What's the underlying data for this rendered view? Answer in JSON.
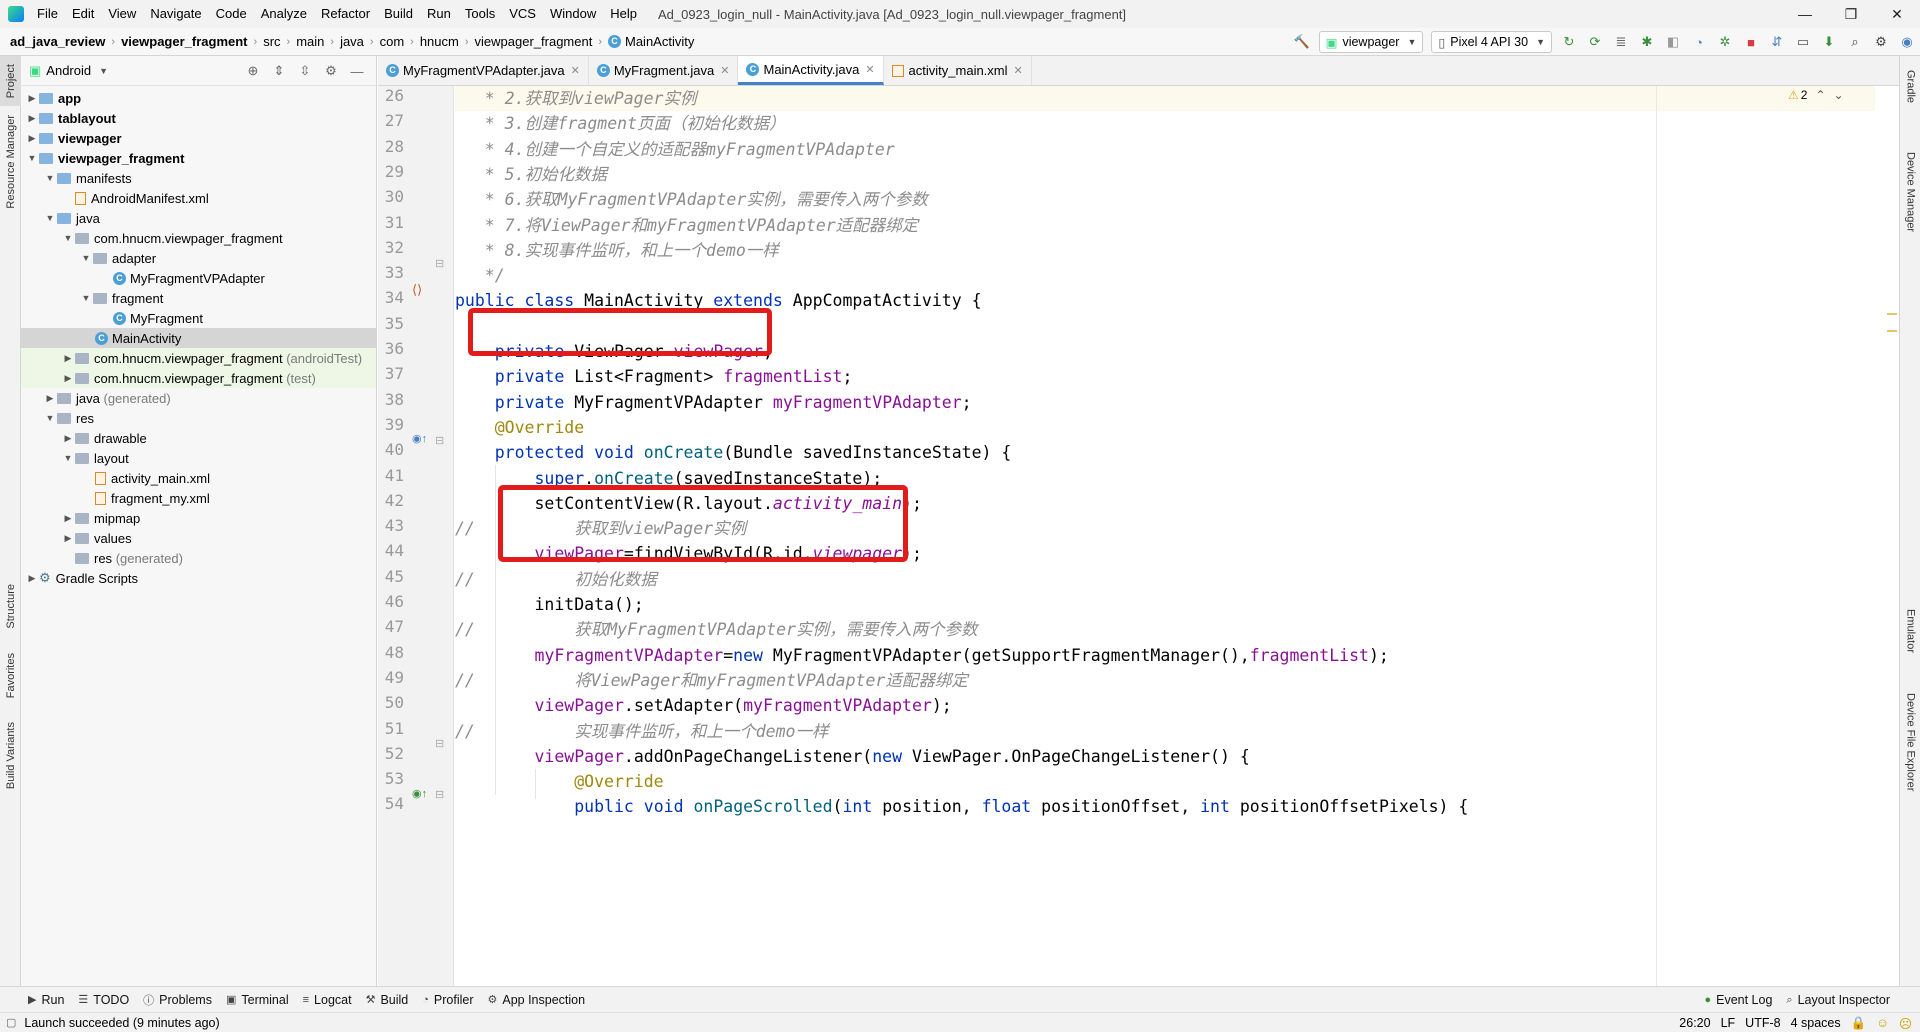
{
  "menubar": {
    "items": [
      "File",
      "Edit",
      "View",
      "Navigate",
      "Code",
      "Analyze",
      "Refactor",
      "Build",
      "Run",
      "Tools",
      "VCS",
      "Window",
      "Help"
    ],
    "window_title": "Ad_0923_login_null - MainActivity.java [Ad_0923_login_null.viewpager_fragment]",
    "window_buttons": [
      "—",
      "❐",
      "✕"
    ]
  },
  "breadcrumb": {
    "items": [
      "ad_java_review",
      "viewpager_fragment",
      "src",
      "main",
      "java",
      "com",
      "hnucm",
      "viewpager_fragment"
    ],
    "current": "MainActivity"
  },
  "toolbar": {
    "run_config": "viewpager",
    "device": "Pixel 4 API 30"
  },
  "left_tool_windows": [
    "Project",
    "Resource Manager",
    "Structure",
    "Favorites",
    "Build Variants"
  ],
  "right_tool_windows": [
    "Gradle",
    "Device Manager",
    "Emulator",
    "Device File Explorer"
  ],
  "project_panel": {
    "view": "Android",
    "tree": [
      {
        "label": "app",
        "bold": true
      },
      {
        "label": "tablayout",
        "bold": true
      },
      {
        "label": "viewpager",
        "bold": true
      },
      {
        "label": "viewpager_fragment",
        "bold": true
      },
      {
        "label": "manifests"
      },
      {
        "label": "AndroidManifest.xml"
      },
      {
        "label": "java"
      },
      {
        "label": "com.hnucm.viewpager_fragment"
      },
      {
        "label": "adapter"
      },
      {
        "label": "MyFragmentVPAdapter"
      },
      {
        "label": "fragment"
      },
      {
        "label": "MyFragment"
      },
      {
        "label": "MainActivity"
      },
      {
        "label": "com.hnucm.viewpager_fragment",
        "suffix": "(androidTest)"
      },
      {
        "label": "com.hnucm.viewpager_fragment",
        "suffix": "(test)"
      },
      {
        "label": "java",
        "suffix": "(generated)"
      },
      {
        "label": "res"
      },
      {
        "label": "drawable"
      },
      {
        "label": "layout"
      },
      {
        "label": "activity_main.xml"
      },
      {
        "label": "fragment_my.xml"
      },
      {
        "label": "mipmap"
      },
      {
        "label": "values"
      },
      {
        "label": "res",
        "suffix": "(generated)"
      },
      {
        "label": "Gradle Scripts"
      }
    ]
  },
  "editor_tabs": [
    "MyFragmentVPAdapter.java",
    "MyFragment.java",
    "MainActivity.java",
    "activity_main.xml"
  ],
  "editor": {
    "warning_count": "2",
    "line_numbers": [
      "26",
      "27",
      "28",
      "29",
      "30",
      "31",
      "32",
      "33",
      "34",
      "35",
      "36",
      "37",
      "38",
      "39",
      "40",
      "41",
      "42",
      "43",
      "44",
      "45",
      "46",
      "47",
      "48",
      "49",
      "50",
      "51",
      "52",
      "53",
      "54"
    ],
    "lines": [
      "   * 2.获取到viewPager实例",
      "   * 3.创建fragment页面（初始化数据）",
      "   * 4.创建一个自定义的适配器myFragmentVPAdapter",
      "   * 5.初始化数据",
      "   * 6.获取MyFragmentVPAdapter实例，需要传入两个参数",
      "   * 7.将ViewPager和myFragmentVPAdapter适配器绑定",
      "   * 8.实现事件监听，和上一个demo一样",
      "   */",
      "public class MainActivity extends AppCompatActivity {",
      "",
      "    private ViewPager viewPager;",
      "    private List<Fragment> fragmentList;",
      "    private MyFragmentVPAdapter myFragmentVPAdapter;",
      "    @Override",
      "    protected void onCreate(Bundle savedInstanceState) {",
      "        super.onCreate(savedInstanceState);",
      "        setContentView(R.layout.activity_main);",
      "//          获取到viewPager实例",
      "        viewPager=findViewById(R.id.viewpager);",
      "//          初始化数据",
      "        initData();",
      "//          获取MyFragmentVPAdapter实例，需要传入两个参数",
      "        myFragmentVPAdapter=new MyFragmentVPAdapter(getSupportFragmentManager(),fragmentList);",
      "//          将ViewPager和myFragmentVPAdapter适配器绑定",
      "        viewPager.setAdapter(myFragmentVPAdapter);",
      "//          实现事件监听，和上一个demo一样",
      "        viewPager.addOnPageChangeListener(new ViewPager.OnPageChangeListener() {",
      "            @Override",
      "            public void onPageScrolled(int position, float positionOffset, int positionOffsetPixels) {"
    ]
  },
  "bottom_tools": [
    "Run",
    "TODO",
    "Problems",
    "Terminal",
    "Logcat",
    "Build",
    "Profiler",
    "App Inspection"
  ],
  "bottom_right_tools": [
    "Event Log",
    "Layout Inspector"
  ],
  "status": {
    "message": "Launch succeeded (9 minutes ago)",
    "position": "26:20",
    "line_sep": "LF",
    "encoding": "UTF-8",
    "indent": "4 spaces"
  },
  "colors": {
    "keyword": "#0033b3",
    "field": "#871094",
    "comment": "#8c8c8c",
    "annotation": "#9e880d",
    "method": "#00627a",
    "highlight_box": "#e21b1b",
    "tab_accent": "#4083c9"
  }
}
